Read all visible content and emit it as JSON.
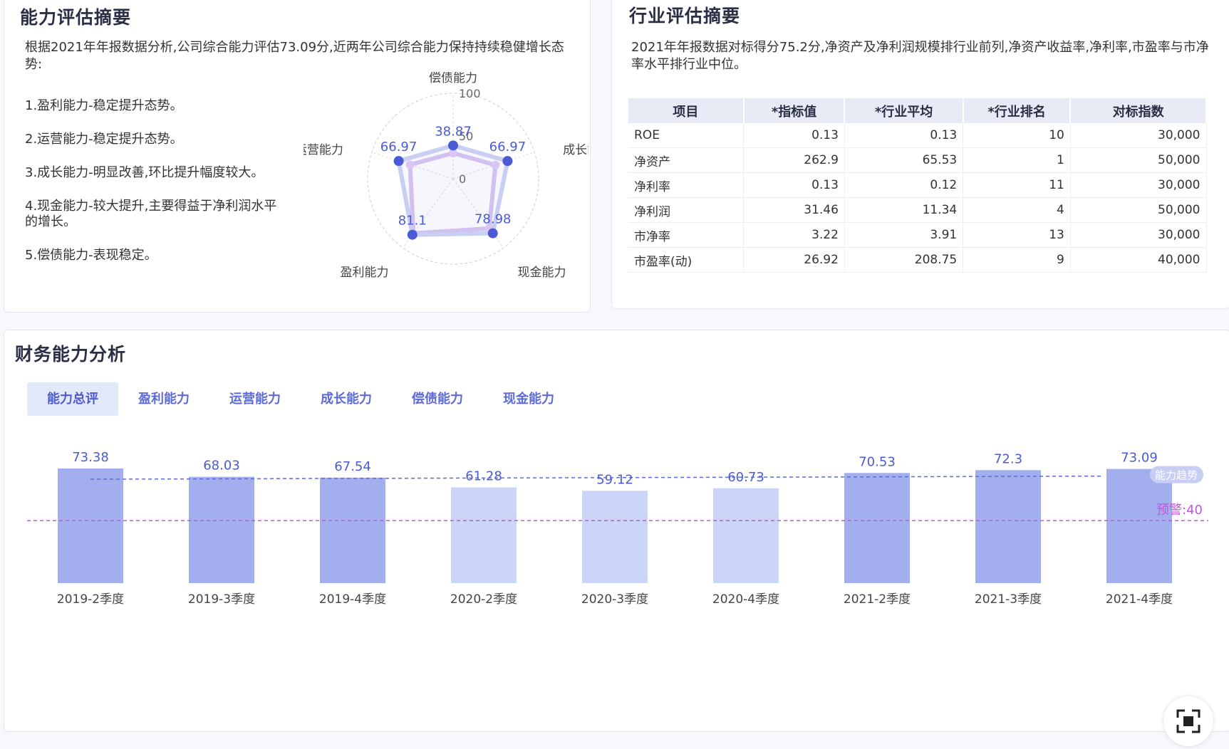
{
  "ability": {
    "title": "能力评估摘要",
    "summary": "根据2021年年报数据分析,公司综合能力评估73.09分,近两年公司综合能力保持持续稳健增长态势:",
    "points": [
      "1.盈利能力-稳定提升态势。",
      "2.运营能力-稳定提升态势。",
      "3.成长能力-明显改善,环比提升幅度较大。",
      "4.现金能力-较大提升,主要得益于净利润水平的增长。",
      "5.偿债能力-表现稳定。"
    ],
    "radar": {
      "axes": [
        "偿债能力",
        "成长能力",
        "现金能力",
        "盈利能力",
        "运营能力"
      ],
      "max": 100,
      "scale_labels": [
        "100",
        "50",
        "0"
      ],
      "current": [
        38.87,
        66.97,
        78.98,
        81.1,
        66.97
      ],
      "previous": [
        30,
        52,
        72,
        79,
        53
      ],
      "current_labels": [
        "38.87",
        "66.97",
        "78.98",
        "81.1",
        "66.97"
      ],
      "colors": {
        "current": "#4b5bd6",
        "previous": "#d9c6f2"
      }
    }
  },
  "industry": {
    "title": "行业评估摘要",
    "summary": "2021年年报数据对标得分75.2分,净资产及净利润规模排行业前列,净资产收益率,净利率,市盈率与市净率水平排行业中位。",
    "columns": [
      "项目",
      "*指标值",
      "*行业平均",
      "*行业排名",
      "对标指数"
    ],
    "rows": [
      [
        "ROE",
        "0.13",
        "0.13",
        "10",
        "30,000"
      ],
      [
        "净资产",
        "262.9",
        "65.53",
        "1",
        "50,000"
      ],
      [
        "净利率",
        "0.13",
        "0.12",
        "11",
        "30,000"
      ],
      [
        "净利润",
        "31.46",
        "11.34",
        "4",
        "50,000"
      ],
      [
        "市净率",
        "3.22",
        "3.91",
        "13",
        "30,000"
      ],
      [
        "市盈率(动)",
        "26.92",
        "208.75",
        "9",
        "40,000"
      ]
    ]
  },
  "finance": {
    "title": "财务能力分析",
    "tabs": [
      "能力总评",
      "盈利能力",
      "运营能力",
      "成长能力",
      "偿债能力",
      "现金能力"
    ],
    "active_tab": 0
  },
  "chart_data": {
    "type": "bar",
    "categories": [
      "2019-2季度",
      "2019-3季度",
      "2019-4季度",
      "2020-2季度",
      "2020-3季度",
      "2020-4季度",
      "2021-2季度",
      "2021-3季度",
      "2021-4季度"
    ],
    "values": [
      73.38,
      68.03,
      67.54,
      61.28,
      59.12,
      60.73,
      70.53,
      72.3,
      73.09
    ],
    "value_labels": [
      "73.38",
      "68.03",
      "67.54",
      "61.28",
      "59.12",
      "60.73",
      "70.53",
      "72.3",
      "73.09"
    ],
    "ylim": [
      0,
      73.38
    ],
    "trend": {
      "label": "能力趋势",
      "start": 66.5,
      "end": 68.5,
      "color": "#5c6bd8"
    },
    "warning": {
      "label": "预警:40",
      "value": 40,
      "color": "#c358d8"
    },
    "colors": {
      "high": "#a3aeee",
      "low": "#cbd5f7",
      "label": "#4b5bd6"
    },
    "title": "",
    "xlabel": "",
    "ylabel": ""
  }
}
